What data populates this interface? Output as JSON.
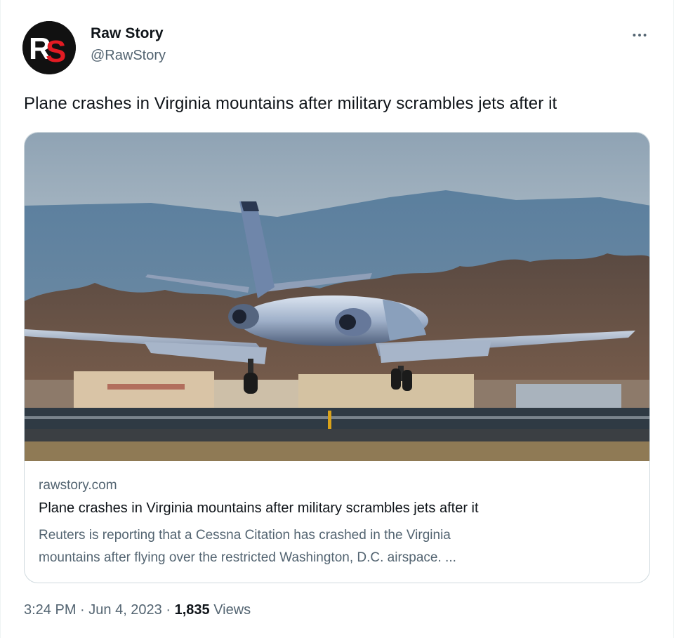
{
  "author": {
    "display_name": "Raw Story",
    "handle": "@RawStory",
    "avatar_text": "RS",
    "avatar_colors": {
      "background": "#111111",
      "r": "#ffffff",
      "s": "#e31b23"
    }
  },
  "tweet": {
    "text": "Plane crashes in Virginia mountains after military scrambles jets after it",
    "more_icon": "more-horizontal-icon"
  },
  "card": {
    "image_description_icon": "photo",
    "domain": "rawstory.com",
    "title": "Plane crashes in Virginia mountains after military scrambles jets after it",
    "description_line1": "Reuters is reporting that a Cessna Citation has crashed in the Virginia",
    "description_line2": "mountains after flying over the restricted Washington, D.C. airspace. ..."
  },
  "meta": {
    "time": "3:24 PM",
    "separator": " · ",
    "date": "Jun 4, 2023",
    "views_count": "1,835",
    "views_label": " Views"
  },
  "colors": {
    "text_primary": "#0f1419",
    "text_secondary": "#536471",
    "border": "#cfd9de"
  }
}
